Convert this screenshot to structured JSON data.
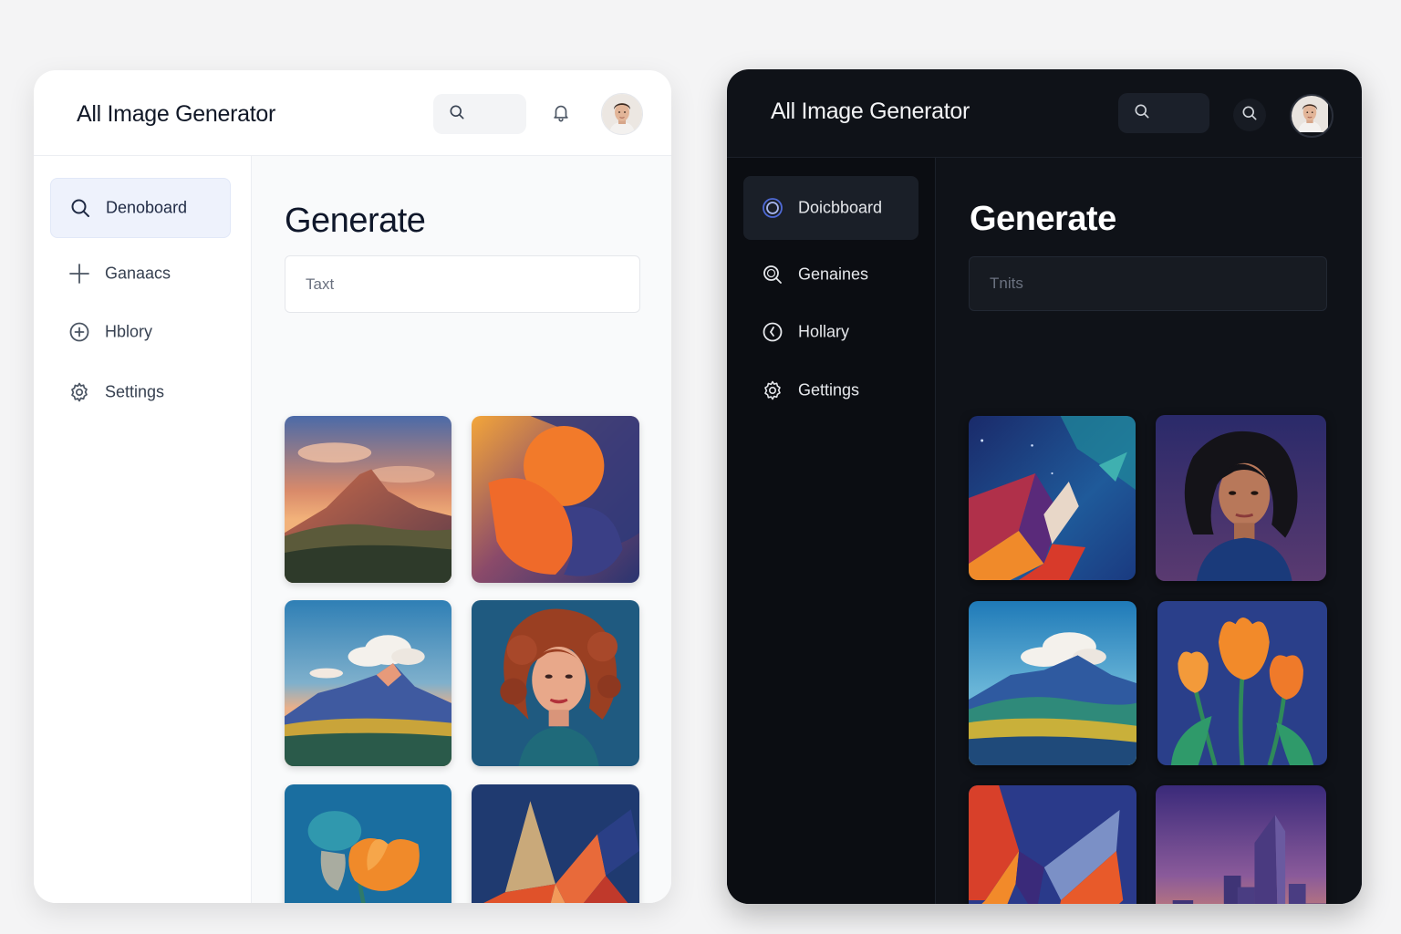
{
  "light": {
    "app_title": "All Image Generator",
    "search": {
      "placeholder": ""
    },
    "nav": [
      {
        "label": "Denoboard",
        "icon": "search-icon",
        "active": true
      },
      {
        "label": "Ganaacs",
        "icon": "plus-icon",
        "active": false
      },
      {
        "label": "Hblory",
        "icon": "plus-circle-icon",
        "active": false
      },
      {
        "label": "Settings",
        "icon": "gear-icon",
        "active": false
      }
    ],
    "content": {
      "title": "Generate",
      "prompt_placeholder": "Taxt",
      "images": [
        "mountain-sunset",
        "abstract-orange",
        "mountain-clouds",
        "woman-portrait",
        "tulip-flower",
        "geometric-abstract"
      ]
    }
  },
  "dark": {
    "app_title": "All Image Generator",
    "search": {
      "placeholder": ""
    },
    "nav": [
      {
        "label": "Doicbboard",
        "icon": "ring-icon",
        "active": true
      },
      {
        "label": "Genaines",
        "icon": "search-icon",
        "active": false
      },
      {
        "label": "Hollary",
        "icon": "clock-icon",
        "active": false
      },
      {
        "label": "Gettings",
        "icon": "gear-icon",
        "active": false
      }
    ],
    "content": {
      "title": "Generate",
      "prompt_placeholder": "Tnits",
      "images": [
        "abstract-space",
        "woman-portrait",
        "mountain-landscape",
        "orange-tulips",
        "geometric-abstract",
        "city-skyline"
      ]
    }
  }
}
